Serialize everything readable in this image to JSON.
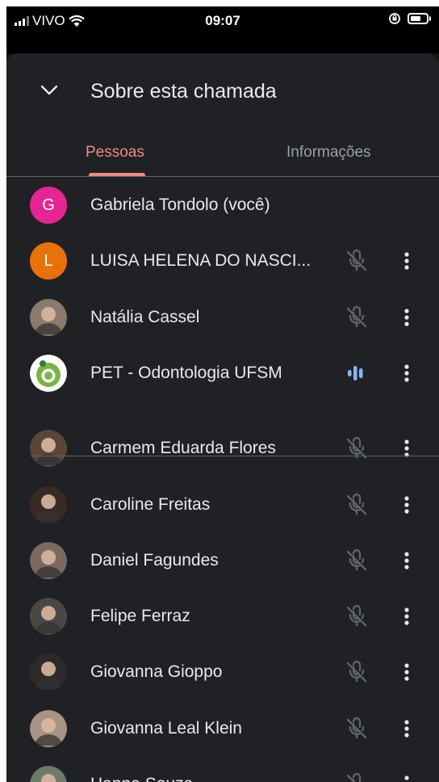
{
  "status_bar": {
    "carrier": "VIVO",
    "time": "09:07"
  },
  "header": {
    "title": "Sobre esta chamada"
  },
  "tabs": [
    {
      "label": "Pessoas",
      "active": true
    },
    {
      "label": "Informações",
      "active": false
    }
  ],
  "colors": {
    "accent": "#f28b82",
    "speaking": "#8ab4f8"
  },
  "participants": [
    {
      "name": "Gabriela Tondolo (você)",
      "initial": "G",
      "avatar_color": "#e52592",
      "mic": "none"
    },
    {
      "name": "LUISA HELENA DO NASCI...",
      "initial": "L",
      "avatar_color": "#e8710a",
      "mic": "muted"
    },
    {
      "name": "Natália Cassel",
      "initial": "",
      "avatar_color": "#8a7a6c",
      "mic": "muted"
    },
    {
      "name": "PET - Odontologia UFSM",
      "initial": "",
      "avatar_color": "#ffffff",
      "mic": "speaking"
    },
    {
      "name": "Carmem Eduarda Flores",
      "initial": "",
      "avatar_color": "#5a4638",
      "mic": "muted"
    },
    {
      "name": "Caroline Freitas",
      "initial": "",
      "avatar_color": "#3a2a24",
      "mic": "muted"
    },
    {
      "name": "Daniel Fagundes",
      "initial": "",
      "avatar_color": "#7a6a60",
      "mic": "muted"
    },
    {
      "name": "Felipe Ferraz",
      "initial": "",
      "avatar_color": "#4a4744",
      "mic": "muted"
    },
    {
      "name": "Giovanna Gioppo",
      "initial": "",
      "avatar_color": "#2e2a2a",
      "mic": "muted"
    },
    {
      "name": "Giovanna Leal Klein",
      "initial": "",
      "avatar_color": "#a89484",
      "mic": "muted"
    },
    {
      "name": "Hanna Souza",
      "initial": "",
      "avatar_color": "#6d7a6a",
      "mic": "muted"
    }
  ]
}
